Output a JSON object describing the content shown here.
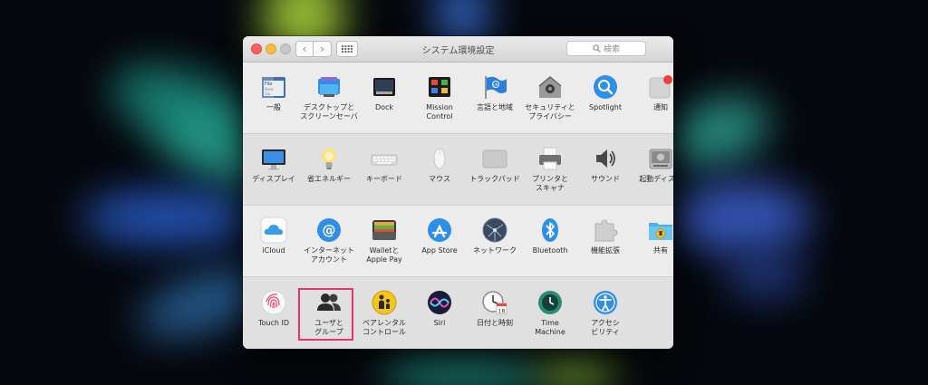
{
  "window": {
    "title": "システム環境設定",
    "search_placeholder": "検索"
  },
  "rows": [
    [
      {
        "label": "一般",
        "icon": "general-icon"
      },
      {
        "label": "デスクトップと\nスクリーンセーバ",
        "icon": "desktop-icon"
      },
      {
        "label": "Dock",
        "icon": "dock-icon"
      },
      {
        "label": "Mission\nControl",
        "icon": "mission-control-icon"
      },
      {
        "label": "言語と地域",
        "icon": "flag-icon"
      },
      {
        "label": "セキュリティと\nプライバシー",
        "icon": "house-lock-icon"
      },
      {
        "label": "Spotlight",
        "icon": "spotlight-icon"
      },
      {
        "label": "通知",
        "icon": "notifications-icon"
      }
    ],
    [
      {
        "label": "ディスプレイ",
        "icon": "display-icon"
      },
      {
        "label": "省エネルギー",
        "icon": "bulb-icon"
      },
      {
        "label": "キーボード",
        "icon": "keyboard-icon"
      },
      {
        "label": "マウス",
        "icon": "mouse-icon"
      },
      {
        "label": "トラックパッド",
        "icon": "trackpad-icon"
      },
      {
        "label": "プリンタと\nスキャナ",
        "icon": "printer-icon"
      },
      {
        "label": "サウンド",
        "icon": "speaker-icon"
      },
      {
        "label": "起動ディスク",
        "icon": "disk-icon"
      }
    ],
    [
      {
        "label": "iCloud",
        "icon": "icloud-icon"
      },
      {
        "label": "インターネット\nアカウント",
        "icon": "at-icon"
      },
      {
        "label": "Walletと\nApple Pay",
        "icon": "wallet-icon"
      },
      {
        "label": "App Store",
        "icon": "app-store-icon"
      },
      {
        "label": "ネットワーク",
        "icon": "network-icon"
      },
      {
        "label": "Bluetooth",
        "icon": "bluetooth-icon"
      },
      {
        "label": "機能拡張",
        "icon": "puzzle-icon"
      },
      {
        "label": "共有",
        "icon": "sharing-folder-icon"
      }
    ],
    [
      {
        "label": "Touch ID",
        "icon": "fingerprint-icon"
      },
      {
        "label": "ユーザと\nグループ",
        "icon": "users-icon"
      },
      {
        "label": "ペアレンタル\nコントロール",
        "icon": "parental-icon"
      },
      {
        "label": "Siri",
        "icon": "siri-icon"
      },
      {
        "label": "日付と時刻",
        "icon": "clock-icon"
      },
      {
        "label": "Time\nMachine",
        "icon": "time-machine-icon"
      },
      {
        "label": "アクセシ\nビリティ",
        "icon": "accessibility-icon"
      }
    ]
  ],
  "icon_glyphs": {
    "general": "File\nNew\nOp",
    "calendar_day": "18",
    "flag": "UN"
  },
  "highlight_color": "#e9356e"
}
